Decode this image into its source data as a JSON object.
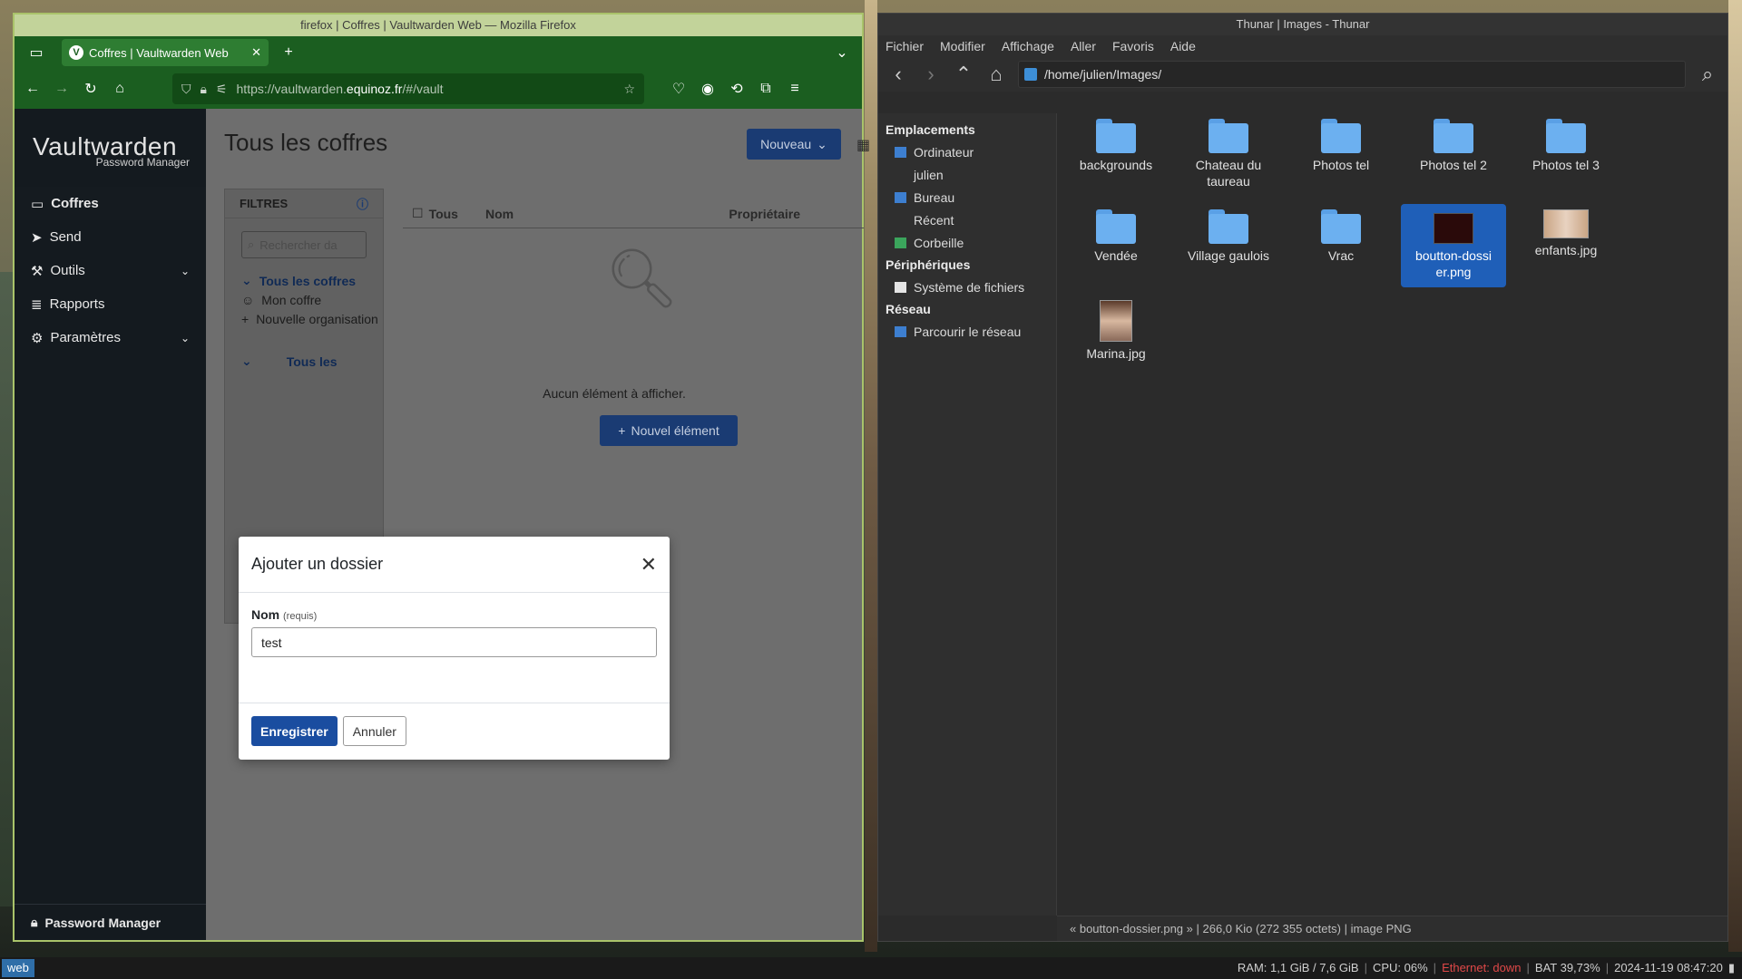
{
  "firefox": {
    "window_title": "firefox | Coffres | Vaultwarden Web — Mozilla Firefox",
    "tab_title": "Coffres | Vaultwarden Web",
    "url_prefix": "https://vaultwarden.",
    "url_domain": "equinoz.fr",
    "url_suffix": "/#/vault"
  },
  "vaultwarden": {
    "logo_name": "Vaultwarden",
    "logo_sub": "Password Manager",
    "nav": [
      {
        "label": "Coffres"
      },
      {
        "label": "Send"
      },
      {
        "label": "Outils"
      },
      {
        "label": "Rapports"
      },
      {
        "label": "Paramètres"
      }
    ],
    "footer": "Password Manager",
    "page_title": "Tous les coffres",
    "new_button": "Nouveau",
    "filters_title": "FILTRES",
    "search_placeholder": "Rechercher da",
    "filter_items": [
      "Tous les coffres",
      "Mon coffre",
      "Nouvelle organisation",
      "Tous les"
    ],
    "col_all": "Tous",
    "col_name": "Nom",
    "col_owner": "Propriétaire",
    "empty_text": "Aucun élément à afficher.",
    "new_item_button": "Nouvel élément",
    "modal": {
      "title": "Ajouter un dossier",
      "label": "Nom",
      "required": "(requis)",
      "value": "test",
      "save": "Enregistrer",
      "cancel": "Annuler"
    }
  },
  "thunar": {
    "window_title": "Thunar | Images - Thunar",
    "menu": [
      "Fichier",
      "Modifier",
      "Affichage",
      "Aller",
      "Favoris",
      "Aide"
    ],
    "path": "/home/julien/Images/",
    "sidebar": {
      "places_title": "Emplacements",
      "places": [
        "Ordinateur",
        "julien",
        "Bureau",
        "Récent",
        "Corbeille"
      ],
      "devices_title": "Périphériques",
      "devices": [
        "Système de fichiers"
      ],
      "network_title": "Réseau",
      "network": [
        "Parcourir le réseau"
      ]
    },
    "files": [
      {
        "name": "backgrounds",
        "kind": "folder"
      },
      {
        "name": "Chateau du taureau",
        "kind": "folder"
      },
      {
        "name": "Photos tel",
        "kind": "folder"
      },
      {
        "name": "Photos tel 2",
        "kind": "folder"
      },
      {
        "name": "Photos tel 3",
        "kind": "folder"
      },
      {
        "name": "Vendée",
        "kind": "folder"
      },
      {
        "name": "Village gaulois",
        "kind": "folder"
      },
      {
        "name": "Vrac",
        "kind": "folder"
      },
      {
        "name": "boutton-dossier.png",
        "kind": "image",
        "selected": true
      },
      {
        "name": "enfants.jpg",
        "kind": "image"
      },
      {
        "name": "Marina.jpg",
        "kind": "image"
      }
    ],
    "status": "« boutton-dossier.png »  |  266,0 Kio (272 355 octets)  |  image PNG"
  },
  "panel": {
    "workspace": "web",
    "ram": "RAM: 1,1 GiB / 7,6 GiB",
    "cpu": "CPU: 06%",
    "ethernet": "Ethernet: down",
    "battery": "BAT 39,73%",
    "datetime": "2024-11-19 08:47:20"
  },
  "colors": {
    "firefox_accent": "#1b5e20",
    "vw_primary": "#1a4da0",
    "thunar_selection": "#1f5fb8",
    "folder": "#6cb0f0"
  }
}
